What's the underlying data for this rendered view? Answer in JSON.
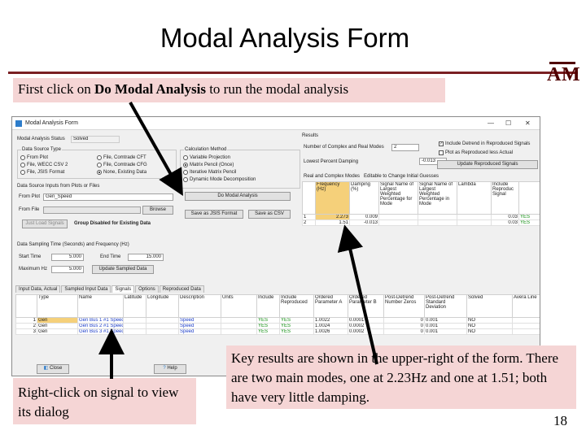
{
  "slide": {
    "title": "Modal Analysis Form",
    "logo": "A M",
    "callout_top": {
      "before": "First click on ",
      "bold": "Do Modal Analysis",
      "after": " to run the modal analysis"
    },
    "callout_left": "Right-click on signal to view its dialog",
    "callout_right": "Key results are shown in the upper-right of the form. There are two main modes, one at 2.23Hz and one at 1.51; both have very little damping.",
    "page_number": "18",
    "colors": {
      "callout_bg": "#f5d5d5",
      "rule": "#7a1f22",
      "logo": "#500000"
    }
  },
  "window": {
    "title": "Modal Analysis Form",
    "status_label": "Modal Analysis Status",
    "status_value": "Solved",
    "data_source": {
      "title": "Data Source Type",
      "options": [
        "From Plot",
        "File, WECC CSV 2",
        "File, JSIS Format",
        "File, Comtrade CFT",
        "File, Comtrade CFG",
        "None, Existing Data"
      ],
      "selected": "None, Existing Data"
    },
    "calc_method": {
      "title": "Calculation Method",
      "options": [
        "Variable Projection",
        "Matrix Pencil (Once)",
        "Iterative Matrix Pencil",
        "Dynamic Mode Decomposition"
      ],
      "selected": "Matrix Pencil (Once)"
    },
    "do_modal_button": "Do Modal Analysis",
    "save_jsis_button": "Save as JSIS Format",
    "save_csv_button": "Save as CSV",
    "source_inputs_label": "Data Source Inputs from Plots or Files",
    "from_plot_label": "From Plot",
    "from_plot_value": "Gen_Speed",
    "from_file_label": "From File",
    "browse_button": "Browse",
    "just_load_button": "Just Load Signals",
    "group_disabled_text": "Group Disabled for Existing Data",
    "sampling_title": "Data Sampling Time (Seconds) and Frequency (Hz)",
    "start_time_label": "Start Time",
    "start_time_value": "5.000",
    "end_time_label": "End Time",
    "end_time_value": "15.000",
    "max_hz_label": "Maximum Hz",
    "max_hz_value": "5.000",
    "update_sampled_button": "Update Sampled Data",
    "results": {
      "title": "Results",
      "num_modes_label": "Number of Complex and Real Modes",
      "num_modes_value": "2",
      "lowest_damping_label": "Lowest Percent Damping",
      "lowest_damping_value": "-0.013",
      "include_detrend": "Include Detrend in Reproduced Signals",
      "plot_reproduced": "Plot as Reproduced less Actual",
      "update_reproduced_button": "Update Reproduced Signals",
      "modes_label": "Real and Complex Modes",
      "modes_note": "Editable to Change Initial Guesses",
      "columns": [
        "Frequency (Hz)",
        "Damping (%)",
        "Signal Name of Largest Weighted Percentage for Mode",
        "Signal Name of Largest Weighted Percentage in Mode",
        "Lambda",
        "Include Reproduc Signal"
      ],
      "rows": [
        {
          "n": "1",
          "freq": "2.273",
          "damp": "0.009",
          "lambda": "0.03",
          "inc": "YES"
        },
        {
          "n": "2",
          "freq": "1.51",
          "damp": "-0.013",
          "lambda": "0.03",
          "inc": "YES"
        }
      ]
    },
    "tabs": [
      "Input Data, Actual",
      "Sampled Input Data",
      "Signals",
      "Options",
      "Reproduced Data"
    ],
    "active_tab": "Signals",
    "signals": {
      "columns": [
        "Type",
        "Name",
        "Latitude",
        "Longitude",
        "Description",
        "Units",
        "Include",
        "Include Reproduced",
        "Ordered Parameter A",
        "Ordered Parameter B",
        "Post-Detrend Number Zeros",
        "Post-Detrend Standard Deviation",
        "Solved",
        "Avera Line"
      ],
      "rows": [
        {
          "n": "1",
          "type": "Gen",
          "name": "Gen Bus 1 #1 Speed",
          "desc": "Speed",
          "inc": "YES",
          "incr": "YES",
          "pa": "1.0022",
          "pb": "0.0001",
          "nz": "0",
          "sd": "0.001",
          "solved": "NO"
        },
        {
          "n": "2",
          "type": "Gen",
          "name": "Gen Bus 2 #1 Speed",
          "desc": "Speed",
          "inc": "YES",
          "incr": "YES",
          "pa": "1.0024",
          "pb": "0.0002",
          "nz": "0",
          "sd": "0.001",
          "solved": "NO"
        },
        {
          "n": "3",
          "type": "Gen",
          "name": "Gen Bus 3 #1 Speed",
          "desc": "Speed",
          "inc": "YES",
          "incr": "YES",
          "pa": "1.0026",
          "pb": "0.0002",
          "nz": "0",
          "sd": "0.001",
          "solved": "NO"
        }
      ]
    },
    "close_button": "Close",
    "help_button": "Help"
  }
}
